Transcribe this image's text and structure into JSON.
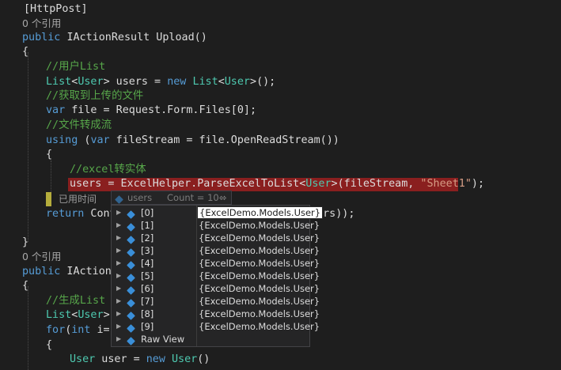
{
  "code": {
    "l1": "[HttpPost]",
    "ref1": "0 个引用",
    "l3_public": "public",
    "l3_rest": "IActionResult Upload()",
    "brace_open": "{",
    "cmt_userlist": "//用户List",
    "l6_list": "List",
    "l6_lt": "<",
    "l6_user": "User",
    "l6_gt": ">",
    "l6_users": " users = ",
    "l6_new": "new",
    "l6_sp": " ",
    "l6_list2": "List",
    "l6_tail": "();",
    "cmt_getfile": "//获取到上传的文件",
    "l8_var": "var",
    "l8_rest": " file = Request.Form.Files[0];",
    "cmt_stream": "//文件转成流",
    "l10_using": "using",
    "l10_p": " (",
    "l10_var": "var",
    "l10_rest": " fileStream = file.OpenReadStream())",
    "brace_open2": "{",
    "cmt_excel": "//excel转实体",
    "l13_a": "users = ExcelHelper.ParseExcelToList<",
    "l13_user": "User",
    "l13_b": ">(fileStream, ",
    "l13_str": "\"Sheet1\"",
    "l13_c": ");",
    "brace_close2": "}",
    "elapsed": "已用时间",
    "l15_return": "return",
    "l15_rest": " Cont",
    "l15_tail": "sers));",
    "brace_close": "}",
    "ref2": "0 个引用",
    "l18_public": "public",
    "l18_rest": " IActionR",
    "brace_open3": "{",
    "cmt_gen": "//生成List",
    "l21_list": "List",
    "l21_lt": "<",
    "l21_user": "User",
    "l21_gt": ">",
    "l22_for": "for",
    "l22_paren": "(",
    "l22_int": "int",
    "l22_rest": " i=1",
    "brace_open4": "{",
    "l24_user": "User",
    "l24_mid": " user = ",
    "l24_new": "new",
    "l24_sp": " ",
    "l24_user2": "User",
    "l24_tail": "()"
  },
  "datatip": {
    "variable": "users",
    "count": "Count = 10",
    "pin": "⬄",
    "items": [
      {
        "name": "[0]",
        "value": "{ExcelDemo.Models.User}"
      },
      {
        "name": "[1]",
        "value": "{ExcelDemo.Models.User}"
      },
      {
        "name": "[2]",
        "value": "{ExcelDemo.Models.User}"
      },
      {
        "name": "[3]",
        "value": "{ExcelDemo.Models.User}"
      },
      {
        "name": "[4]",
        "value": "{ExcelDemo.Models.User}"
      },
      {
        "name": "[5]",
        "value": "{ExcelDemo.Models.User}"
      },
      {
        "name": "[6]",
        "value": "{ExcelDemo.Models.User}"
      },
      {
        "name": "[7]",
        "value": "{ExcelDemo.Models.User}"
      },
      {
        "name": "[8]",
        "value": "{ExcelDemo.Models.User}"
      },
      {
        "name": "[9]",
        "value": "{ExcelDemo.Models.User}"
      }
    ],
    "raw_view": "Raw View",
    "expand_arrow": "▶"
  },
  "colors": {
    "background": "#1e1e1e",
    "keyword": "#569cd6",
    "type": "#4ec9b0",
    "comment": "#57a64a",
    "string": "#d69d85",
    "breakpoint_highlight": "#8a1f1f"
  }
}
